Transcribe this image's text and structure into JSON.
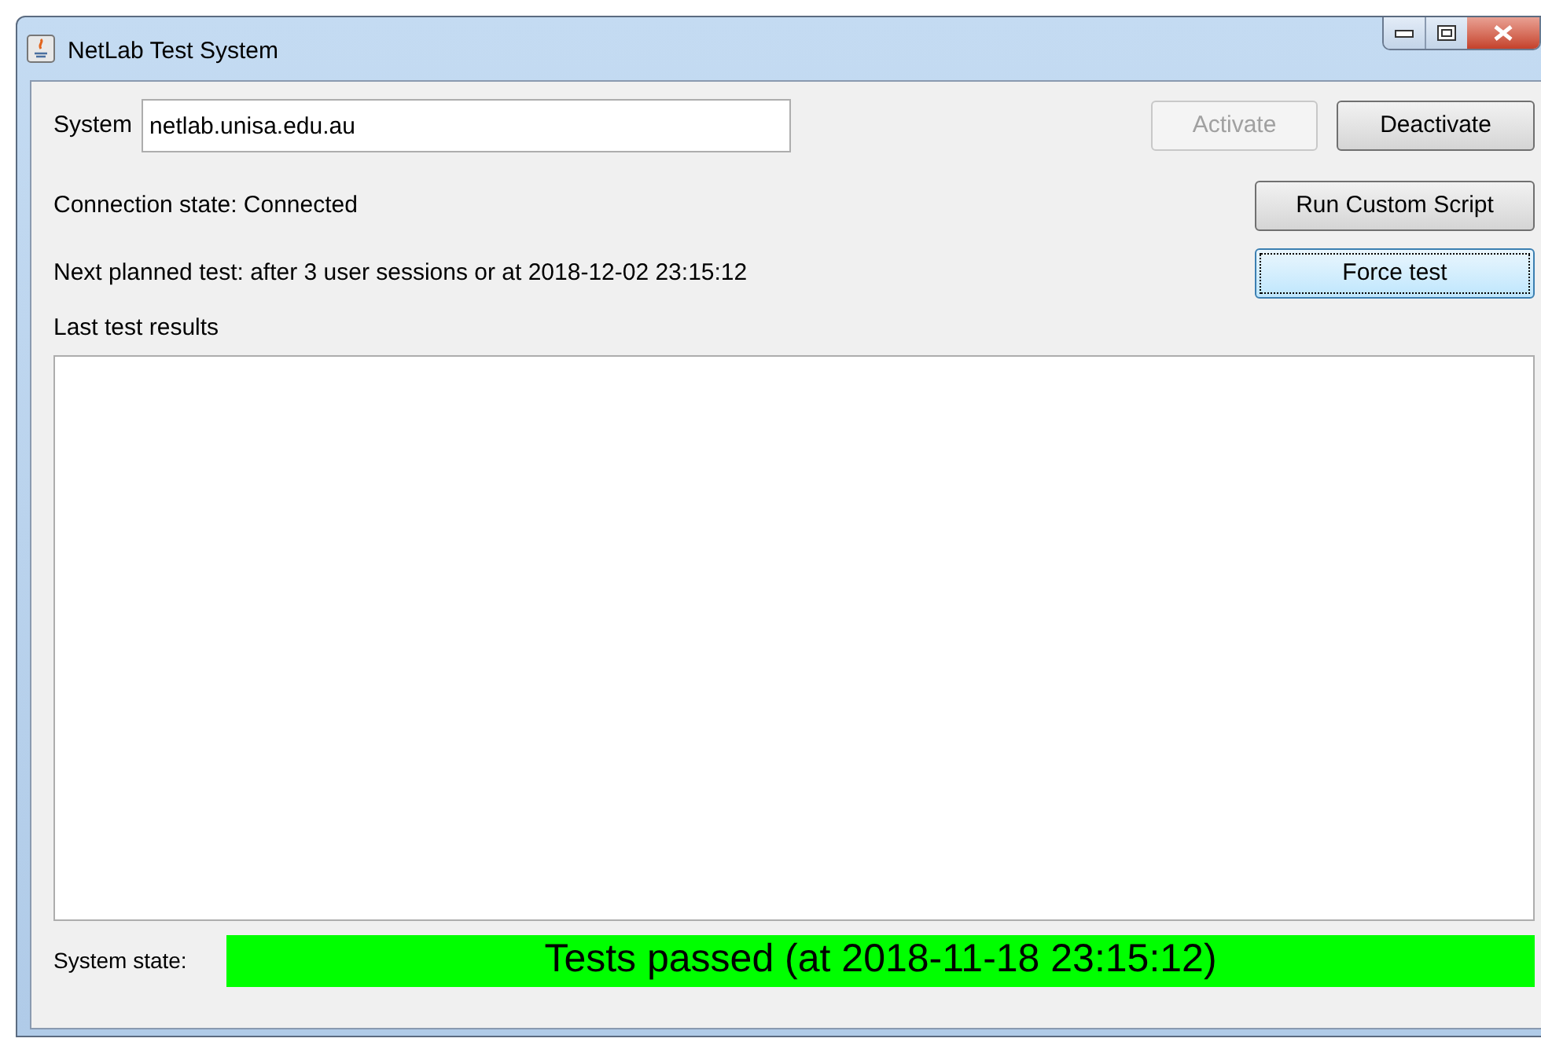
{
  "window": {
    "title": "NetLab Test System",
    "controls": [
      {
        "kind": "minimize"
      },
      {
        "kind": "maximize"
      },
      {
        "kind": "close"
      }
    ]
  },
  "system": {
    "label": "System",
    "value": "netlab.unisa.edu.au"
  },
  "buttons": [
    {
      "label": "Activate",
      "disabled": true,
      "focused": false
    },
    {
      "label": "Deactivate",
      "disabled": false,
      "focused": false
    },
    {
      "label": "Run Custom Script",
      "disabled": false,
      "focused": false
    },
    {
      "label": "Force test",
      "disabled": false,
      "focused": true
    }
  ],
  "connection_state": "Connection state: Connected",
  "next_test": "Next planned test: after 3 user sessions or at 2018-12-02 23:15:12",
  "results": {
    "label": "Last test results"
  },
  "system_state": {
    "label": "System state:",
    "value": "Tests passed (at 2018-11-18 23:15:12)",
    "color": "#00ff00"
  }
}
